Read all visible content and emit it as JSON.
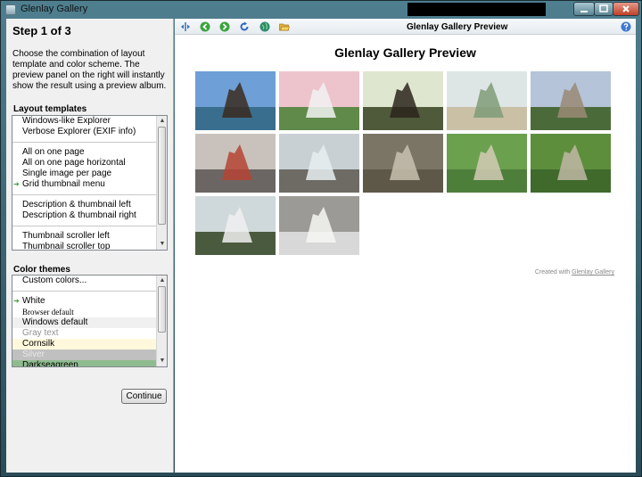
{
  "window": {
    "title": "Glenlay Gallery"
  },
  "left": {
    "step_title": "Step 1 of 3",
    "description": "Choose the combination of layout template and color scheme. The preview panel on the right will instantly show the result using a preview album.",
    "layout_label": "Layout templates",
    "layout_items": [
      {
        "label": "Windows-like Explorer"
      },
      {
        "label": "Verbose Explorer (EXIF info)"
      },
      {
        "sep": true
      },
      {
        "label": "All on one page"
      },
      {
        "label": "All on one page horizontal"
      },
      {
        "label": "Single image per page"
      },
      {
        "label": "Grid thumbnail menu",
        "checked": true
      },
      {
        "sep": true
      },
      {
        "label": "Description & thumbnail left"
      },
      {
        "label": "Description & thumbnail right"
      },
      {
        "sep": true
      },
      {
        "label": "Thumbnail scroller left"
      },
      {
        "label": "Thumbnail scroller top"
      }
    ],
    "theme_label": "Color themes",
    "theme_items": [
      {
        "label": "Custom colors..."
      },
      {
        "sep": true
      },
      {
        "label": "White",
        "checked": true
      },
      {
        "label": "Browser default",
        "serif": true
      },
      {
        "label": "Windows default",
        "bg": "#f0f0f0"
      },
      {
        "label": "Gray text",
        "fg": "#909090"
      },
      {
        "label": "Cornsilk",
        "bg": "#fff8dc"
      },
      {
        "label": "Silver",
        "bg": "#c0c0c0",
        "fg": "#e8e8e8"
      },
      {
        "label": "Darkseagreen",
        "bg": "#8fbc8f"
      }
    ],
    "continue_label": "Continue"
  },
  "preview": {
    "toolbar_title": "Glenlay Gallery Preview",
    "heading": "Glenlay Gallery Preview",
    "credit_prefix": "Created with ",
    "credit_link": "Glenlay Gallery",
    "thumbnails": [
      {
        "name": "tall-ship-harbor-thumbnail",
        "sky": "#6e9fd6",
        "ground": "#3a6e8e",
        "subject": "#3b2a20"
      },
      {
        "name": "lighthouse-thumbnail",
        "sky": "#eec4cc",
        "ground": "#5f8a4a",
        "subject": "#f2f2f2"
      },
      {
        "name": "sailing-ship-dock-thumbnail",
        "sky": "#dfe6cf",
        "ground": "#4f5a3a",
        "subject": "#2b241c"
      },
      {
        "name": "beach-hills-thumbnail",
        "sky": "#dde6e4",
        "ground": "#c9c0a6",
        "subject": "#7f9b78"
      },
      {
        "name": "mission-tower-thumbnail",
        "sky": "#b5c4d8",
        "ground": "#4b6a3a",
        "subject": "#9a8a76"
      },
      {
        "name": "city-street-thumbnail",
        "sky": "#c9c2bc",
        "ground": "#6b6664",
        "subject": "#b54434"
      },
      {
        "name": "canyon-waterfall-thumbnail",
        "sky": "#c8d0d4",
        "ground": "#6d6b64",
        "subject": "#e8eef0"
      },
      {
        "name": "marmot-rocks-thumbnail",
        "sky": "#7b7566",
        "ground": "#5e5848",
        "subject": "#c9c1b0"
      },
      {
        "name": "marmot-grass-thumbnail",
        "sky": "#6aa04e",
        "ground": "#4e7f3a",
        "subject": "#d4cbb6"
      },
      {
        "name": "marmot-meadow-thumbnail",
        "sky": "#5d8e3c",
        "ground": "#3f6a2c",
        "subject": "#bfb7a4"
      },
      {
        "name": "snowy-forest-thumbnail",
        "sky": "#cfd8da",
        "ground": "#4a5a3e",
        "subject": "#f0f0f0"
      },
      {
        "name": "mountain-goat-thumbnail",
        "sky": "#9c9a96",
        "ground": "#d8d8d8",
        "subject": "#f7f7f5"
      }
    ]
  }
}
